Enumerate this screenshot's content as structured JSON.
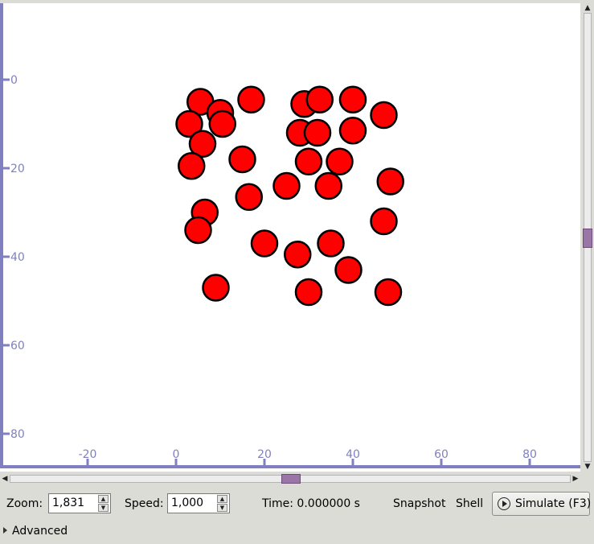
{
  "canvas": {
    "axis_color": "#8080c0",
    "particle_fill": "#ff0000",
    "particle_stroke": "#000000",
    "x_ticks": [
      "0",
      "-20",
      "0",
      "20",
      "40",
      "60",
      "80"
    ],
    "y_ticks": [
      "0",
      "20",
      "40",
      "60",
      "80"
    ],
    "particles": [
      [
        5.5,
        5
      ],
      [
        10,
        7.5
      ],
      [
        17,
        4.5
      ],
      [
        3,
        10
      ],
      [
        10.5,
        10
      ],
      [
        6,
        14.5
      ],
      [
        29,
        5.5
      ],
      [
        32.5,
        4.5
      ],
      [
        40,
        4.5
      ],
      [
        47,
        8
      ],
      [
        28,
        12
      ],
      [
        32,
        12
      ],
      [
        40,
        11.5
      ],
      [
        3.5,
        19.5
      ],
      [
        15,
        18
      ],
      [
        30,
        18.5
      ],
      [
        37,
        18.5
      ],
      [
        16.5,
        26.5
      ],
      [
        25,
        24
      ],
      [
        34.5,
        24
      ],
      [
        48.5,
        23
      ],
      [
        6.5,
        30
      ],
      [
        5,
        34
      ],
      [
        47,
        32
      ],
      [
        20,
        37
      ],
      [
        27.5,
        39.5
      ],
      [
        35,
        37
      ],
      [
        39,
        43
      ],
      [
        9,
        47
      ],
      [
        30,
        48
      ],
      [
        48,
        48
      ]
    ]
  },
  "toolbar": {
    "zoom_label": "Zoom:",
    "zoom_value": "1,831",
    "speed_label": "Speed:",
    "speed_value": "1,000",
    "time_text": "Time: 0.000000 s",
    "snapshot_label": "Snapshot",
    "shell_label": "Shell",
    "simulate_label": "Simulate (F3)"
  },
  "advanced_label": "Advanced"
}
